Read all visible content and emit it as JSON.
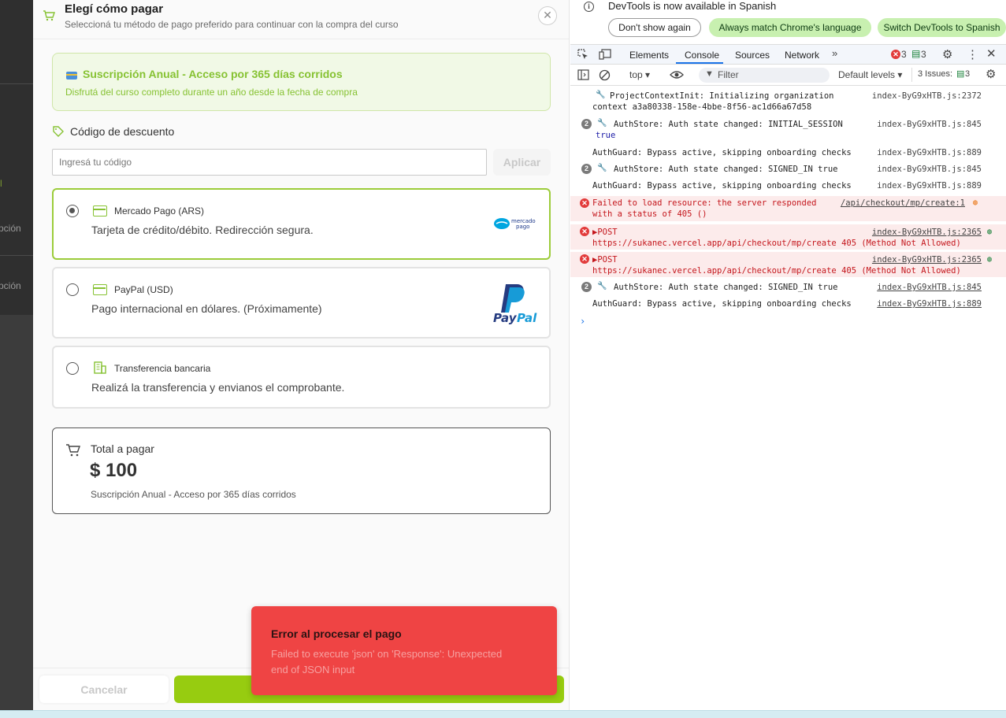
{
  "backdrop": {
    "texts": [
      "pción",
      "pción",
      "l"
    ]
  },
  "modal": {
    "title": "Elegí cómo pagar",
    "subtitle": "Seleccioná tu método de pago preferido para continuar con la compra del curso",
    "close_label": "✕",
    "plan": {
      "title": "Suscripción Anual - Acceso por 365 días corridos",
      "description": "Disfrutá del curso completo durante un año desde la fecha de compra"
    },
    "discount": {
      "label": "Código de descuento",
      "placeholder": "Ingresá tu código",
      "value": "",
      "apply_label": "Aplicar"
    },
    "payment_options": [
      {
        "name": "Mercado Pago (ARS)",
        "description": "Tarjeta de crédito/débito. Redirección segura.",
        "selected": true,
        "logo_text": "mercado pago"
      },
      {
        "name": "PayPal (USD)",
        "description": "Pago internacional en dólares. (Próximamente)",
        "selected": false,
        "logo_text": "PayPal"
      },
      {
        "name": "Transferencia bancaria",
        "description": "Realizá la transferencia y envianos el comprobante.",
        "selected": false
      }
    ],
    "total": {
      "label": "Total a pagar",
      "amount": "$ 100",
      "description": "Suscripción Anual - Acceso por 365 días corridos"
    },
    "footer": {
      "cancel_label": "Cancelar",
      "confirm_label": ""
    }
  },
  "toast": {
    "title": "Error al procesar el pago",
    "message": "Failed to execute 'json' on 'Response': Unexpected end of JSON input"
  },
  "devtools": {
    "banner": {
      "text": "DevTools is now available in Spanish",
      "dont_show": "Don't show again",
      "match_language": "Always match Chrome's language",
      "switch_spanish": "Switch DevTools to Spanish"
    },
    "tabs": [
      "Elements",
      "Console",
      "Sources",
      "Network"
    ],
    "active_tab": "Console",
    "error_count": "3",
    "message_count": "3",
    "filterbar": {
      "context": "top",
      "filter_placeholder": "Filter",
      "levels": "Default levels",
      "issues_label": "3 Issues:",
      "issues_count": "3"
    },
    "logs": [
      {
        "type": "info",
        "lines": [
          "ProjectContextInit: Initializing organization",
          "context a3a80338-158e-4bbe-8f56-ac1d66a67d58"
        ],
        "source": "index-ByG9xHTB.js:2372"
      },
      {
        "type": "info",
        "count": "2",
        "lines": [
          "AuthStore: Auth state changed: INITIAL_SESSION",
          "true"
        ],
        "source": "index-ByG9xHTB.js:845"
      },
      {
        "type": "info",
        "lines": [
          "AuthGuard: Bypass active, skipping onboarding checks"
        ],
        "source": "index-ByG9xHTB.js:889"
      },
      {
        "type": "info",
        "count": "2",
        "lines": [
          "AuthStore: Auth state changed: SIGNED_IN true"
        ],
        "source": "index-ByG9xHTB.js:845"
      },
      {
        "type": "info",
        "lines": [
          "AuthGuard: Bypass active, skipping onboarding checks"
        ],
        "source": "index-ByG9xHTB.js:889"
      },
      {
        "type": "error",
        "lines": [
          "Failed to load resource: the server responded",
          "with a status of 405 ()"
        ],
        "source": "/api/checkout/mp/create:1"
      },
      {
        "type": "error",
        "lines": [
          "▶POST",
          "https://sukanec.vercel.app/api/checkout/mp/create 405 (Method Not Allowed)"
        ],
        "source": "index-ByG9xHTB.js:2365"
      },
      {
        "type": "error",
        "lines": [
          "▶POST",
          "https://sukanec.vercel.app/api/checkout/mp/create 405 (Method Not Allowed)"
        ],
        "source": "index-ByG9xHTB.js:2365"
      },
      {
        "type": "info",
        "count": "2",
        "lines": [
          "AuthStore: Auth state changed: SIGNED_IN true"
        ],
        "source": "index-ByG9xHTB.js:845"
      },
      {
        "type": "info",
        "lines": [
          "AuthGuard: Bypass active, skipping onboarding checks"
        ],
        "source": "index-ByG9xHTB.js:889"
      }
    ],
    "prompt": "›"
  },
  "colors": {
    "brand_green": "#86c232",
    "confirm_green": "#97cc10",
    "toast_red": "#ef4444",
    "devtools_blue": "#1a73e8"
  }
}
